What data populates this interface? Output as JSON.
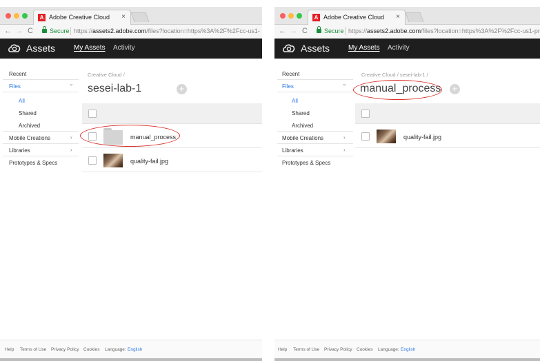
{
  "screens": [
    {
      "browser": {
        "tab_title": "Adobe Creative Cloud",
        "tab_close": "×",
        "favicon_glyph": "A",
        "back": "←",
        "forward": "→",
        "reload": "C",
        "secure_label": "Secure",
        "url_prefix": "https://",
        "url_host": "assets2.adobe.com",
        "url_rest": "/files?location=https%3A%2F%2Fcc-us1-"
      },
      "app": {
        "title": "Assets",
        "nav": {
          "my_assets": "My Assets",
          "activity": "Activity"
        }
      },
      "sidebar": {
        "recent": "Recent",
        "files": "Files",
        "all": "All",
        "shared": "Shared",
        "archived": "Archived",
        "mobile_creations": "Mobile Creations",
        "libraries": "Libraries",
        "prototypes": "Prototypes & Specs",
        "chevron_down": "⌄",
        "chevron_right": "›"
      },
      "main": {
        "breadcrumb": "Creative Cloud  /",
        "title": "sesei-lab-1",
        "add_glyph": "+",
        "rows": [
          {
            "name": "manual_process",
            "kind": "folder",
            "annotated": true
          },
          {
            "name": "quality-fail.jpg",
            "kind": "image",
            "annotated": false
          }
        ]
      },
      "footer": {
        "help": "Help",
        "terms": "Terms of Use",
        "privacy": "Privacy Policy",
        "cookies": "Cookies",
        "language_label": "Language:",
        "language": "English"
      }
    },
    {
      "browser": {
        "tab_title": "Adobe Creative Cloud",
        "tab_close": "×",
        "favicon_glyph": "A",
        "back": "←",
        "forward": "→",
        "reload": "C",
        "secure_label": "Secure",
        "url_prefix": "https://",
        "url_host": "assets2.adobe.com",
        "url_rest": "/files?location=https%3A%2F%2Fcc-us1-pr"
      },
      "app": {
        "title": "Assets",
        "nav": {
          "my_assets": "My Assets",
          "activity": "Activity"
        }
      },
      "sidebar": {
        "recent": "Recent",
        "files": "Files",
        "all": "All",
        "shared": "Shared",
        "archived": "Archived",
        "mobile_creations": "Mobile Creations",
        "libraries": "Libraries",
        "prototypes": "Prototypes & Specs",
        "chevron_down": "⌄",
        "chevron_right": "›"
      },
      "main": {
        "breadcrumb": "Creative Cloud  /  sesei-lab-1  /",
        "title": "manual_process",
        "title_annotated": true,
        "add_glyph": "+",
        "rows": [
          {
            "name": "quality-fail.jpg",
            "kind": "image",
            "annotated": false
          }
        ]
      },
      "footer": {
        "help": "Help",
        "terms": "Terms of Use",
        "privacy": "Privacy Policy",
        "cookies": "Cookies",
        "language_label": "Language:",
        "language": "English"
      }
    }
  ],
  "colors": {
    "accent_blue": "#2d7be5",
    "annotation_red": "#d9322b",
    "app_header_bg": "#1e1e1e"
  },
  "icons": {
    "logo": "creative-cloud-logo-icon",
    "lock": "lock-icon",
    "folder": "folder-icon",
    "image": "image-thumbnail"
  }
}
